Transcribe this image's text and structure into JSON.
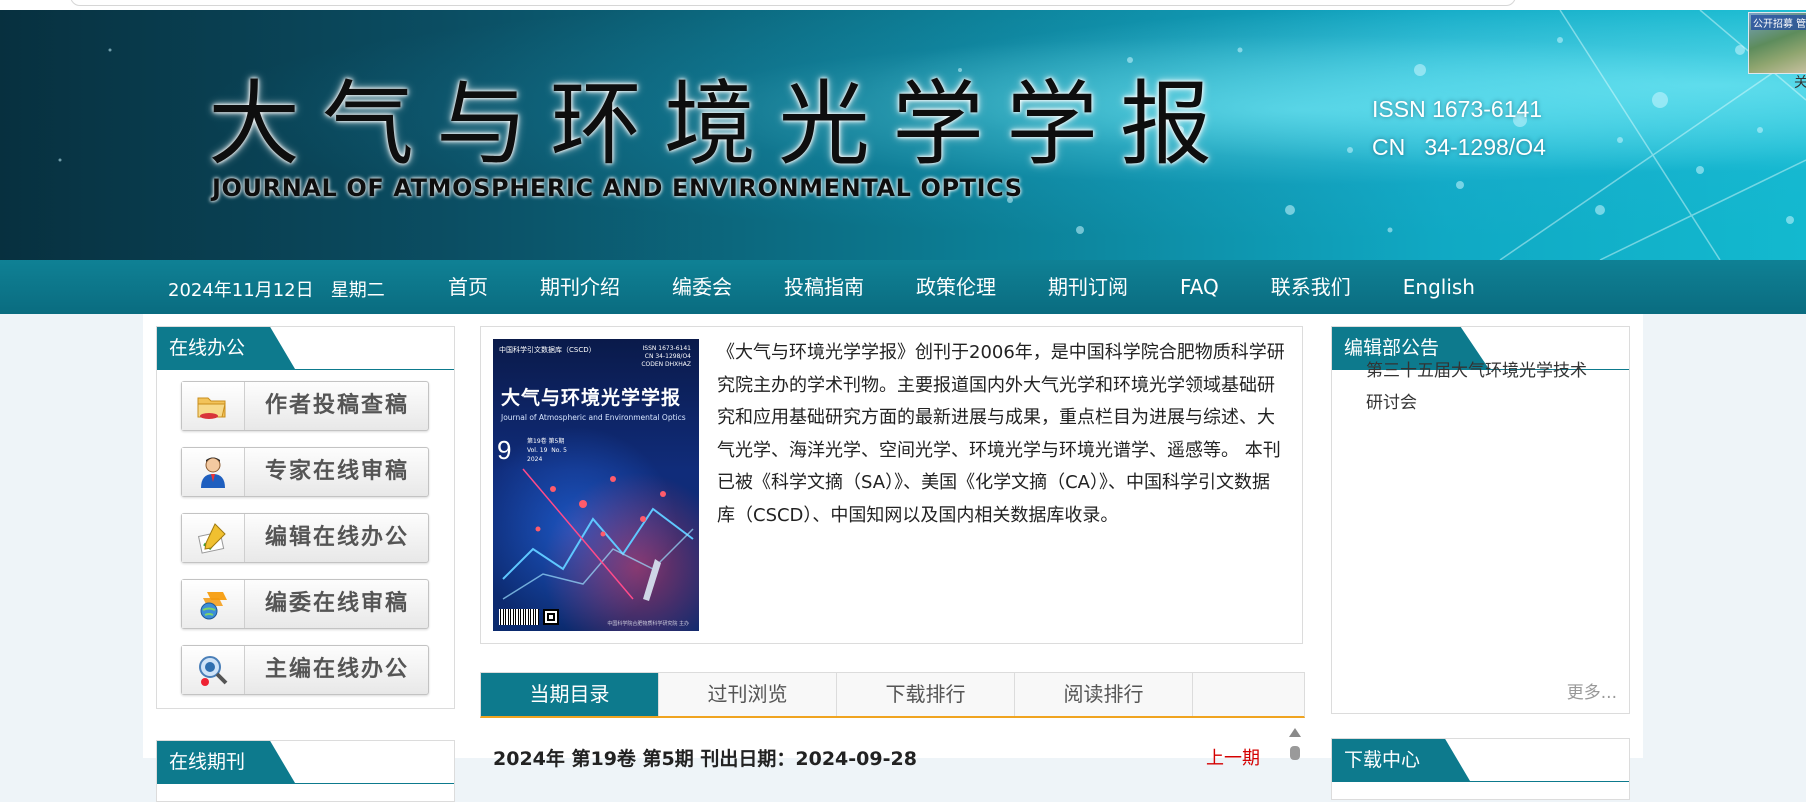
{
  "banner": {
    "title_cn": "大气与环境光学学报",
    "title_en": "JOURNAL OF ATMOSPHERIC AND ENVIRONMENTAL OPTICS",
    "issn": "ISSN 1673-6141",
    "cn": "CN   34-1298/O4",
    "corner_thumb_text": "公开招募 管",
    "corner_mark": "关"
  },
  "nav": {
    "date": "2024年11月12日   星期二",
    "items": [
      "首页",
      "期刊介绍",
      "编委会",
      "投稿指南",
      "政策伦理",
      "期刊订阅",
      "FAQ",
      "联系我们",
      "English"
    ]
  },
  "left": {
    "online_office_title": "在线办公",
    "buttons": [
      {
        "label": "作者投稿查稿",
        "icon": "author-folder-icon"
      },
      {
        "label": "专家在线审稿",
        "icon": "expert-person-icon"
      },
      {
        "label": "编辑在线办公",
        "icon": "editor-pencil-icon"
      },
      {
        "label": "编委在线审稿",
        "icon": "board-globe-icon"
      },
      {
        "label": "主编在线办公",
        "icon": "chief-search-icon"
      }
    ],
    "second_panel_title": "在线期刊"
  },
  "intro": {
    "cover": {
      "top": "中国科学引文数据库（CSCD）",
      "issn": "ISSN 1673-6141\nCN 34-1298/O4\nCODEN DHXHAZ",
      "title": "大气与环境光学学报",
      "en": "Journal of Atmospheric and Environmental Optics",
      "number": "9",
      "vol": "第19卷 第5期\nVol. 19  No. 5\n2024",
      "footer": "中国科学院合肥物质科学研究院 主办"
    },
    "text": "《大气与环境光学学报》创刊于2006年，是中国科学院合肥物质科学研究院主办的学术刊物。主要报道国内外大气光学和环境光学领域基础研究和应用基础研究方面的最新进展与成果，重点栏目为进展与综述、大气光学、海洋光学、空间光学、环境光学与环境光谱学、遥感等。 本刊已被《科学文摘（SA）》、美国《化学文摘（CA）》、中国科学引文数据库（CSCD）、中国知网以及国内相关数据库收录。"
  },
  "tabs": {
    "items": [
      "当期目录",
      "过刊浏览",
      "下载排行",
      "阅读排行"
    ],
    "active_index": 0,
    "issue_line": "2024年 第19卷 第5期 刊出日期：2024-09-28",
    "prev_issue": "上一期"
  },
  "right": {
    "notice_title": "编辑部公告",
    "notice_lines": [
      "第三十五届大气环境光学技术",
      "研讨会"
    ],
    "more": "更多...",
    "download_title": "下载中心"
  }
}
